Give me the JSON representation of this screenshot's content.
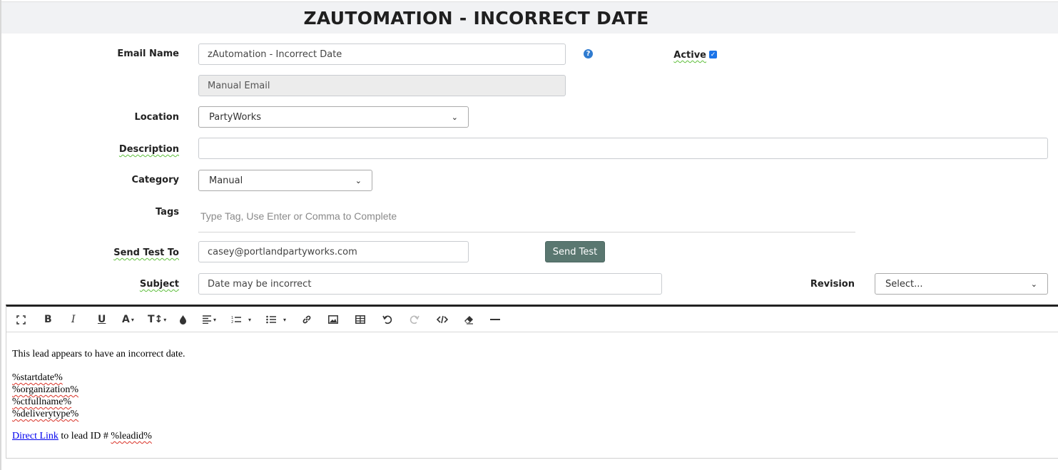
{
  "page_title": "ZAUTOMATION - INCORRECT DATE",
  "form": {
    "email_name_label": "Email Name",
    "email_name_value": "zAutomation - Incorrect Date",
    "active_label": "Active",
    "active_checked": true,
    "type_value": "Manual Email",
    "location_label": "Location",
    "location_value": "PartyWorks",
    "description_label": "Description",
    "description_value": "",
    "category_label": "Category",
    "category_value": "Manual",
    "tags_label": "Tags",
    "tags_placeholder": "Type Tag, Use Enter or Comma to Complete",
    "send_test_label": "Send Test To",
    "send_test_value": "casey@portlandpartyworks.com",
    "send_test_button": "Send Test",
    "subject_label": "Subject",
    "subject_value": "Date may be incorrect",
    "revision_label": "Revision",
    "revision_value": "Select..."
  },
  "editor": {
    "toolbar": [
      "fullscreen-icon",
      "bold-icon",
      "italic-icon",
      "underline-icon",
      "font-color-icon",
      "font-size-icon",
      "color-drop-icon",
      "align-icon",
      "ordered-list-icon",
      "unordered-list-icon",
      "link-icon",
      "image-icon",
      "table-icon",
      "undo-icon",
      "redo-icon",
      "code-view-icon",
      "clear-format-icon",
      "horizontal-rule-icon"
    ],
    "intro": "This lead appears to have an incorrect date.",
    "tokens": [
      "%startdate%",
      "%organization%",
      "%ctfullname%",
      "%deliverytype%"
    ],
    "link_text": "Direct Link",
    "link_suffix": " to lead ID # ",
    "lead_token": "%leadid%"
  },
  "colors": {
    "button_bg": "#5a7770",
    "checkbox": "#1a73e8",
    "help_icon": "#2f7bd0",
    "title_bar_bg": "#f1f2f4"
  }
}
